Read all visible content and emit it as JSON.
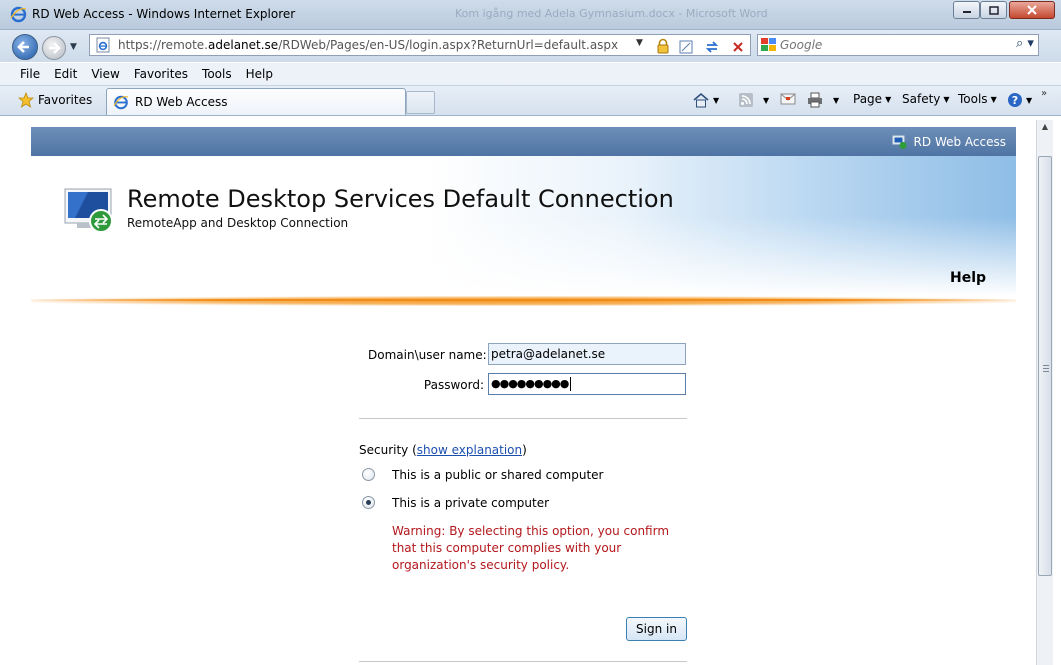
{
  "window": {
    "title": "RD Web Access - Windows Internet Explorer",
    "background_title": "Kom igång med Adela Gymnasium.docx - Microsoft Word"
  },
  "address_bar": {
    "url_prefix": "https://remote.",
    "url_host": "adelanet.se",
    "url_path": "/RDWeb/Pages/en-US/login.aspx?ReturnUrl=default.aspx"
  },
  "search": {
    "placeholder": "Google"
  },
  "menu": [
    "File",
    "Edit",
    "View",
    "Favorites",
    "Tools",
    "Help"
  ],
  "favorites_bar": {
    "favorites_label": "Favorites",
    "tab_title": "RD Web Access",
    "commands": [
      "Page",
      "Safety",
      "Tools"
    ]
  },
  "rd": {
    "top_link": "RD Web Access",
    "title": "Remote Desktop Services Default Connection",
    "subtitle": "RemoteApp and Desktop Connection",
    "help": "Help",
    "form": {
      "username_label": "Domain\\user name:",
      "username_value": "petra@adelanet.se",
      "password_label": "Password:",
      "password_value": "●●●●●●●●●",
      "security_label": "Security (",
      "security_link": "show explanation",
      "security_close": ")",
      "option_public": "This is a public or shared computer",
      "option_private": "This is a private computer",
      "selected_option": "private",
      "warning": "Warning: By selecting this option, you confirm that this computer complies with your organization's security policy.",
      "signin": "Sign in"
    }
  },
  "colors": {
    "accent_blue": "#4f74a4",
    "orange_rule": "#f08c17",
    "warning_red": "#b3171c",
    "link_blue": "#1b4fae"
  }
}
